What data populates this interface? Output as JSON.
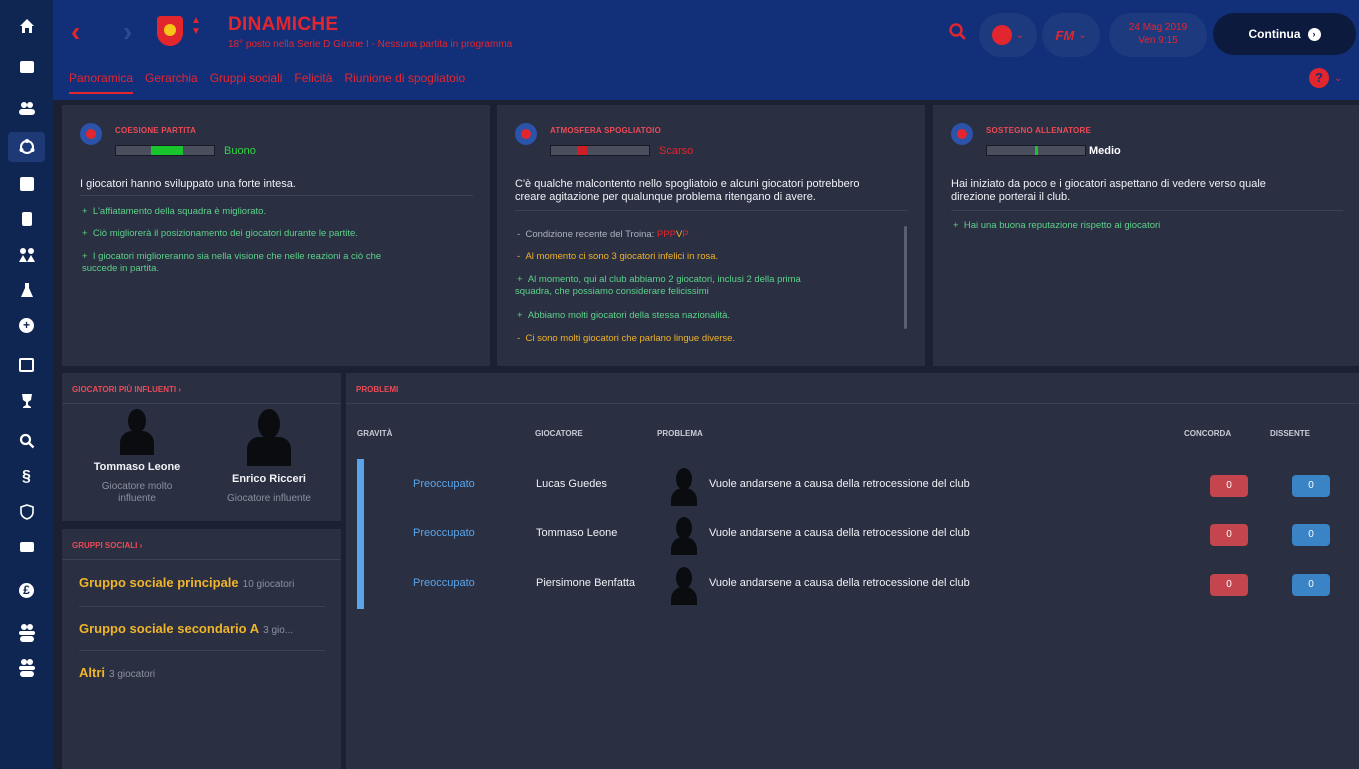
{
  "header": {
    "title": "DINAMICHE",
    "subtitle": "18° posto nella Serie D Girone I - Nessuna partita in programma",
    "back": "‹",
    "forward": "›",
    "date_line1": "24 Mag 2019",
    "date_line2": "Ven 9:15",
    "fm_label": "FM",
    "continue_label": "Continua",
    "tabs": [
      "Panoramica",
      "Gerarchia",
      "Gruppi sociali",
      "Felicità",
      "Riunione di spogliatoio"
    ]
  },
  "cards": {
    "cohesion": {
      "title": "COESIONE PARTITA",
      "rating": "Buono",
      "level": 0.52,
      "description": "I giocatori hanno sviluppato una forte intesa.",
      "bullets": [
        {
          "sign": "+",
          "text": "L'affiatamento della squadra è migliorato."
        },
        {
          "sign": "+",
          "text": "Ciò migliorerà il posizionamento dei giocatori durante le partite."
        },
        {
          "sign": "+",
          "text": "I giocatori miglioreranno sia nella visione che nelle reazioni a ciò che"
        },
        {
          "sign": "",
          "text": "succede in partita."
        }
      ]
    },
    "atmosphere": {
      "title": "ATMOSFERA SPOGLIATOIO",
      "rating": "Scarso",
      "level": 0.32,
      "description_line1": "C'è qualche malcontento nello spogliatoio e alcuni giocatori potrebbero",
      "description_line2": "creare agitazione per qualunque problema ritengano di avere.",
      "form_label": "Condizione recente del Troina:",
      "form_losses": "PPP",
      "form_draw": "V",
      "form_last": "P",
      "bullets": [
        {
          "sign": "-",
          "text": "Al momento ci sono 3 giocatori infelici in rosa."
        },
        {
          "sign": "+",
          "text": "Al momento, qui al club abbiamo 2 giocatori, inclusi 2 della prima"
        },
        {
          "sign": "",
          "text": "squadra, che possiamo considerare felicissimi"
        },
        {
          "sign": "+",
          "text": "Abbiamo molti giocatori della stessa nazionalità."
        },
        {
          "sign": "-",
          "text": "Ci sono molti giocatori che parlano lingue diverse."
        }
      ]
    },
    "support": {
      "title": "SOSTEGNO ALLENATORE",
      "rating": "Medio",
      "level": 0.5,
      "description_line1": "Hai iniziato da poco e i giocatori aspettano di vedere verso quale",
      "description_line2": "direzione porterai il club.",
      "bullets": [
        {
          "sign": "+",
          "text": "Hai una buona reputazione rispetto ai giocatori"
        }
      ]
    }
  },
  "influential": {
    "title": "GIOCATORI PIÙ INFLUENTI ›",
    "players": [
      {
        "name": "Tommaso Leone",
        "role_line1": "Giocatore molto",
        "role_line2": "influente"
      },
      {
        "name": "Enrico Ricceri",
        "role_line1": "Giocatore influente",
        "role_line2": ""
      }
    ]
  },
  "social_groups": {
    "title": "GRUPPI SOCIALI ›",
    "groups": [
      {
        "name": "Gruppo sociale principale",
        "count": "10 giocatori"
      },
      {
        "name": "Gruppo sociale secondario A",
        "count": "3 gio..."
      },
      {
        "name": "Altri",
        "count": "3 giocatori"
      }
    ]
  },
  "problems": {
    "title": "PROBLEMI",
    "columns": {
      "severity": "GRAVITÀ",
      "player": "GIOCATORE",
      "problem": "PROBLEMA",
      "agree": "CONCORDA",
      "disagree": "DISSENTE"
    },
    "rows": [
      {
        "severity": "Preoccupato",
        "player": "Lucas Guedes",
        "problem": "Vuole andarsene a causa della retrocessione del club",
        "agree": "0",
        "disagree": "0"
      },
      {
        "severity": "Preoccupato",
        "player": "Tommaso Leone",
        "problem": "Vuole andarsene a causa della retrocessione del club",
        "agree": "0",
        "disagree": "0"
      },
      {
        "severity": "Preoccupato",
        "player": "Piersimone Benfatta",
        "problem": "Vuole andarsene a causa della retrocessione del club",
        "agree": "0",
        "disagree": "0"
      }
    ]
  },
  "colors": {
    "accent": "#e3262e",
    "positive": "#5dd28a",
    "warning": "#f0b32a",
    "severity": "#5aa4ea"
  },
  "icons": {
    "nav": [
      "home-icon",
      "inbox-icon",
      "squad-icon",
      "dynamics-icon",
      "tactics-icon",
      "data-icon",
      "training-icon",
      "medical-icon",
      "scouting-icon",
      "schedule-icon",
      "competitions-icon",
      "search-icon",
      "finances-icon",
      "club-vision-icon",
      "staff-icon",
      "transfers-icon",
      "u20-icon",
      "u19-icon"
    ]
  }
}
